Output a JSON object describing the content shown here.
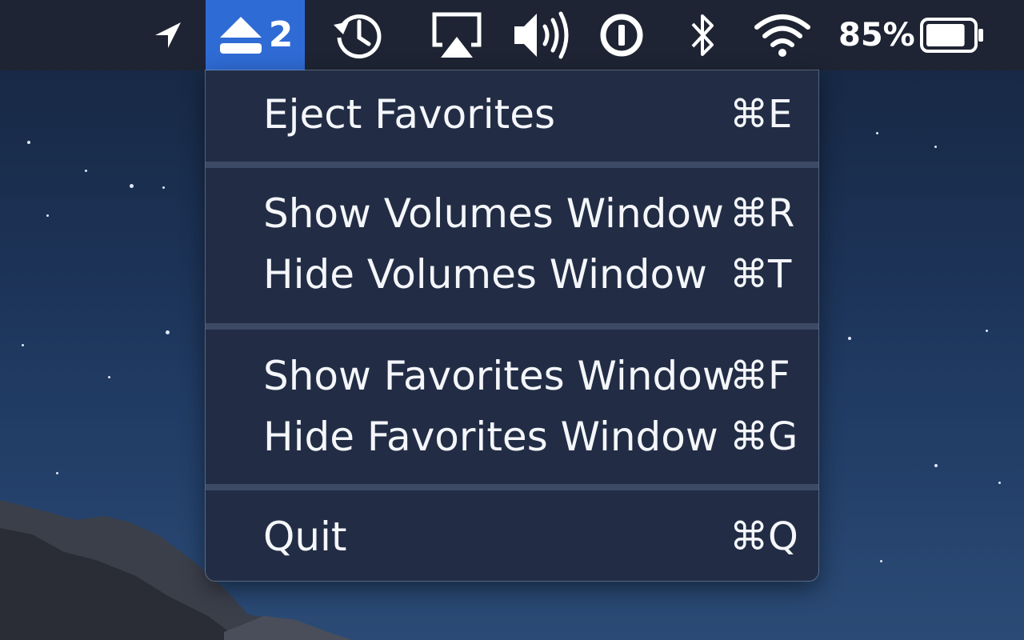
{
  "menubar": {
    "location_icon": "location-arrow-icon",
    "eject_icon": "eject-icon",
    "eject_count": "2",
    "time_machine_icon": "time-machine-icon",
    "airplay_icon": "airplay-icon",
    "volume_icon": "volume-icon",
    "password_icon": "1password-icon",
    "bluetooth_icon": "bluetooth-icon",
    "wifi_icon": "wifi-icon",
    "battery_percent": "85%",
    "battery_level": 0.85,
    "active_color": "#2f6bd4",
    "bar_color": "#1e2433"
  },
  "menu": {
    "items": [
      {
        "label": "Eject Favorites",
        "shortcut": "⌘E"
      },
      {
        "label": "Show Volumes Window",
        "shortcut": "⌘R"
      },
      {
        "label": "Hide Volumes Window",
        "shortcut": "⌘T"
      },
      {
        "label": "Show Favorites Window",
        "shortcut": "⌘F"
      },
      {
        "label": "Hide Favorites Window",
        "shortcut": "⌘G"
      },
      {
        "label": "Quit",
        "shortcut": "⌘Q"
      }
    ],
    "background": "#222d45"
  }
}
